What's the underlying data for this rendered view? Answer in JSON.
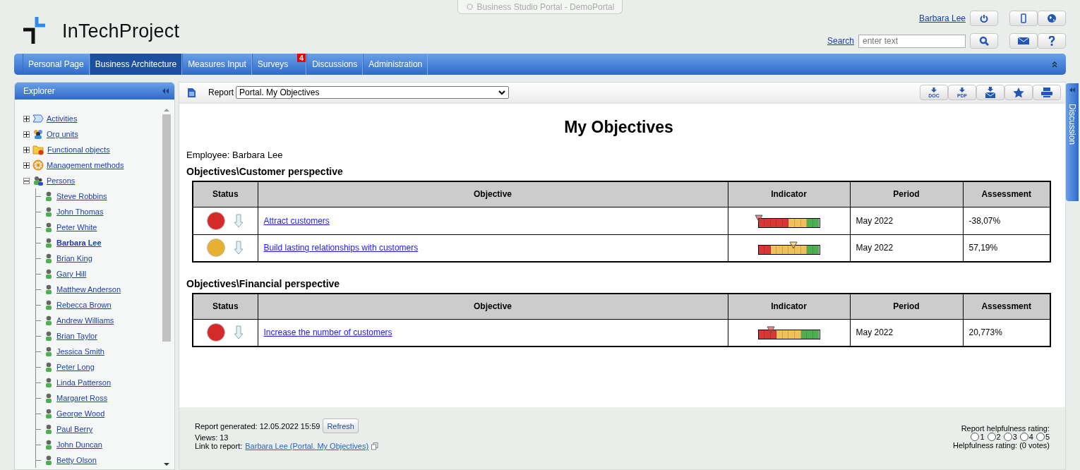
{
  "portal_tab": {
    "title": "Business Studio Portal - DemoPortal"
  },
  "logo": {
    "text": "InTechProject"
  },
  "user": {
    "name": "Barbara Lee"
  },
  "search": {
    "label": "Search",
    "placeholder": "enter text"
  },
  "nav": {
    "tabs": [
      {
        "label": "Personal Page",
        "selected": false
      },
      {
        "label": "Business Architecture",
        "selected": true
      },
      {
        "label": "Measures Input",
        "selected": false
      },
      {
        "label": "Surveys",
        "selected": false,
        "badge": "4"
      },
      {
        "label": "Discussions",
        "selected": false
      },
      {
        "label": "Administration",
        "selected": false
      }
    ]
  },
  "explorer": {
    "title": "Explorer",
    "items": [
      {
        "label": "Activities",
        "kind": "activity",
        "expanded": false
      },
      {
        "label": "Org units",
        "kind": "org",
        "expanded": false
      },
      {
        "label": "Functional objects",
        "kind": "folder",
        "expanded": false
      },
      {
        "label": "Management methods",
        "kind": "method",
        "expanded": false
      },
      {
        "label": "Persons",
        "kind": "persons",
        "expanded": true,
        "children": [
          {
            "label": "Steve Robbins",
            "selected": false
          },
          {
            "label": "John Thomas",
            "selected": false
          },
          {
            "label": "Peter White",
            "selected": false
          },
          {
            "label": "Barbara Lee",
            "selected": true
          },
          {
            "label": "Brian King",
            "selected": false
          },
          {
            "label": "Gary Hill",
            "selected": false
          },
          {
            "label": "Matthew Anderson",
            "selected": false
          },
          {
            "label": "Rebecca Brown",
            "selected": false
          },
          {
            "label": "Andrew Williams",
            "selected": false
          },
          {
            "label": "Brian Taylor",
            "selected": false
          },
          {
            "label": "Jessica Smith",
            "selected": false
          },
          {
            "label": "Peter Long",
            "selected": false
          },
          {
            "label": "Linda Patterson",
            "selected": false
          },
          {
            "label": "Margaret Ross",
            "selected": false
          },
          {
            "label": "George Wood",
            "selected": false
          },
          {
            "label": "Paul Berry",
            "selected": false
          },
          {
            "label": "John Duncan",
            "selected": false
          },
          {
            "label": "Betty Olson",
            "selected": false
          }
        ]
      }
    ]
  },
  "report_bar": {
    "label": "Report",
    "value": "Portal. My Objectives",
    "tools": [
      {
        "kind": "doc",
        "label": "DOC"
      },
      {
        "kind": "pdf",
        "label": "PDF"
      },
      {
        "kind": "mail"
      },
      {
        "kind": "star"
      },
      {
        "kind": "print"
      }
    ]
  },
  "report": {
    "title": "My Objectives",
    "employee": "Employee: Barbara Lee",
    "sections": [
      {
        "heading": "Objectives\\Customer perspective",
        "columns": [
          "Status",
          "Objective",
          "Indicator",
          "Period",
          "Assessment"
        ],
        "rows": [
          {
            "color": "#d42a2a",
            "objective": "Attract customers",
            "level": 0.0,
            "cells": [
              {
                "color": "#d93636"
              },
              {
                "color": "#d93636"
              },
              {
                "color": "#d93636"
              },
              {
                "color": "#d93636"
              },
              {
                "color": "#d93636"
              },
              {
                "color": "#f0c05a"
              },
              {
                "color": "#f0c05a"
              },
              {
                "color": "#f0c05a"
              },
              {
                "color": "#4caf50"
              },
              {
                "color": "#4caf50"
              }
            ],
            "period": "May 2022",
            "assessment": "-38,07%"
          },
          {
            "color": "#e8b030",
            "objective": "Build lasting relationships with customers",
            "level": 0.58,
            "cells": [
              {
                "color": "#d93636"
              },
              {
                "color": "#d93636"
              },
              {
                "color": "#f0c05a"
              },
              {
                "color": "#f0c05a"
              },
              {
                "color": "#f0c05a"
              },
              {
                "color": "#f0c05a"
              },
              {
                "color": "#f0c05a"
              },
              {
                "color": "#f0c05a"
              },
              {
                "color": "#4caf50"
              },
              {
                "color": "#4caf50"
              }
            ],
            "period": "May 2022",
            "assessment": "57,19%"
          }
        ]
      },
      {
        "heading": "Objectives\\Financial perspective",
        "columns": [
          "Status",
          "Objective",
          "Indicator",
          "Period",
          "Assessment"
        ],
        "rows": [
          {
            "color": "#d42a2a",
            "objective": "Increase the number of customers",
            "level": 0.2,
            "cells": [
              {
                "color": "#d93636"
              },
              {
                "color": "#d93636"
              },
              {
                "color": "#d93636"
              },
              {
                "color": "#f0c05a"
              },
              {
                "color": "#f0c05a"
              },
              {
                "color": "#f0c05a"
              },
              {
                "color": "#f0c05a"
              },
              {
                "color": "#4caf50"
              },
              {
                "color": "#4caf50"
              },
              {
                "color": "#4caf50"
              }
            ],
            "period": "May 2022",
            "assessment": "20,773%"
          }
        ]
      }
    ]
  },
  "footer": {
    "generated": "Report generated: 12.05.2022 15:59",
    "refresh": "Refresh",
    "views": "Views: 13",
    "link_label": "Link to report:",
    "link": "Barbara Lee (Portal. My Objectives)",
    "rating_title": "Report helpfulness rating:",
    "ratings": [
      {
        "label": "1",
        "selected": false
      },
      {
        "label": "2",
        "selected": false
      },
      {
        "label": "3",
        "selected": false
      },
      {
        "label": "4",
        "selected": false
      },
      {
        "label": "5",
        "selected": false
      }
    ],
    "rating_summary": "Helpfulness rating: (0 votes)"
  },
  "discussion": {
    "label": "Discussion"
  }
}
